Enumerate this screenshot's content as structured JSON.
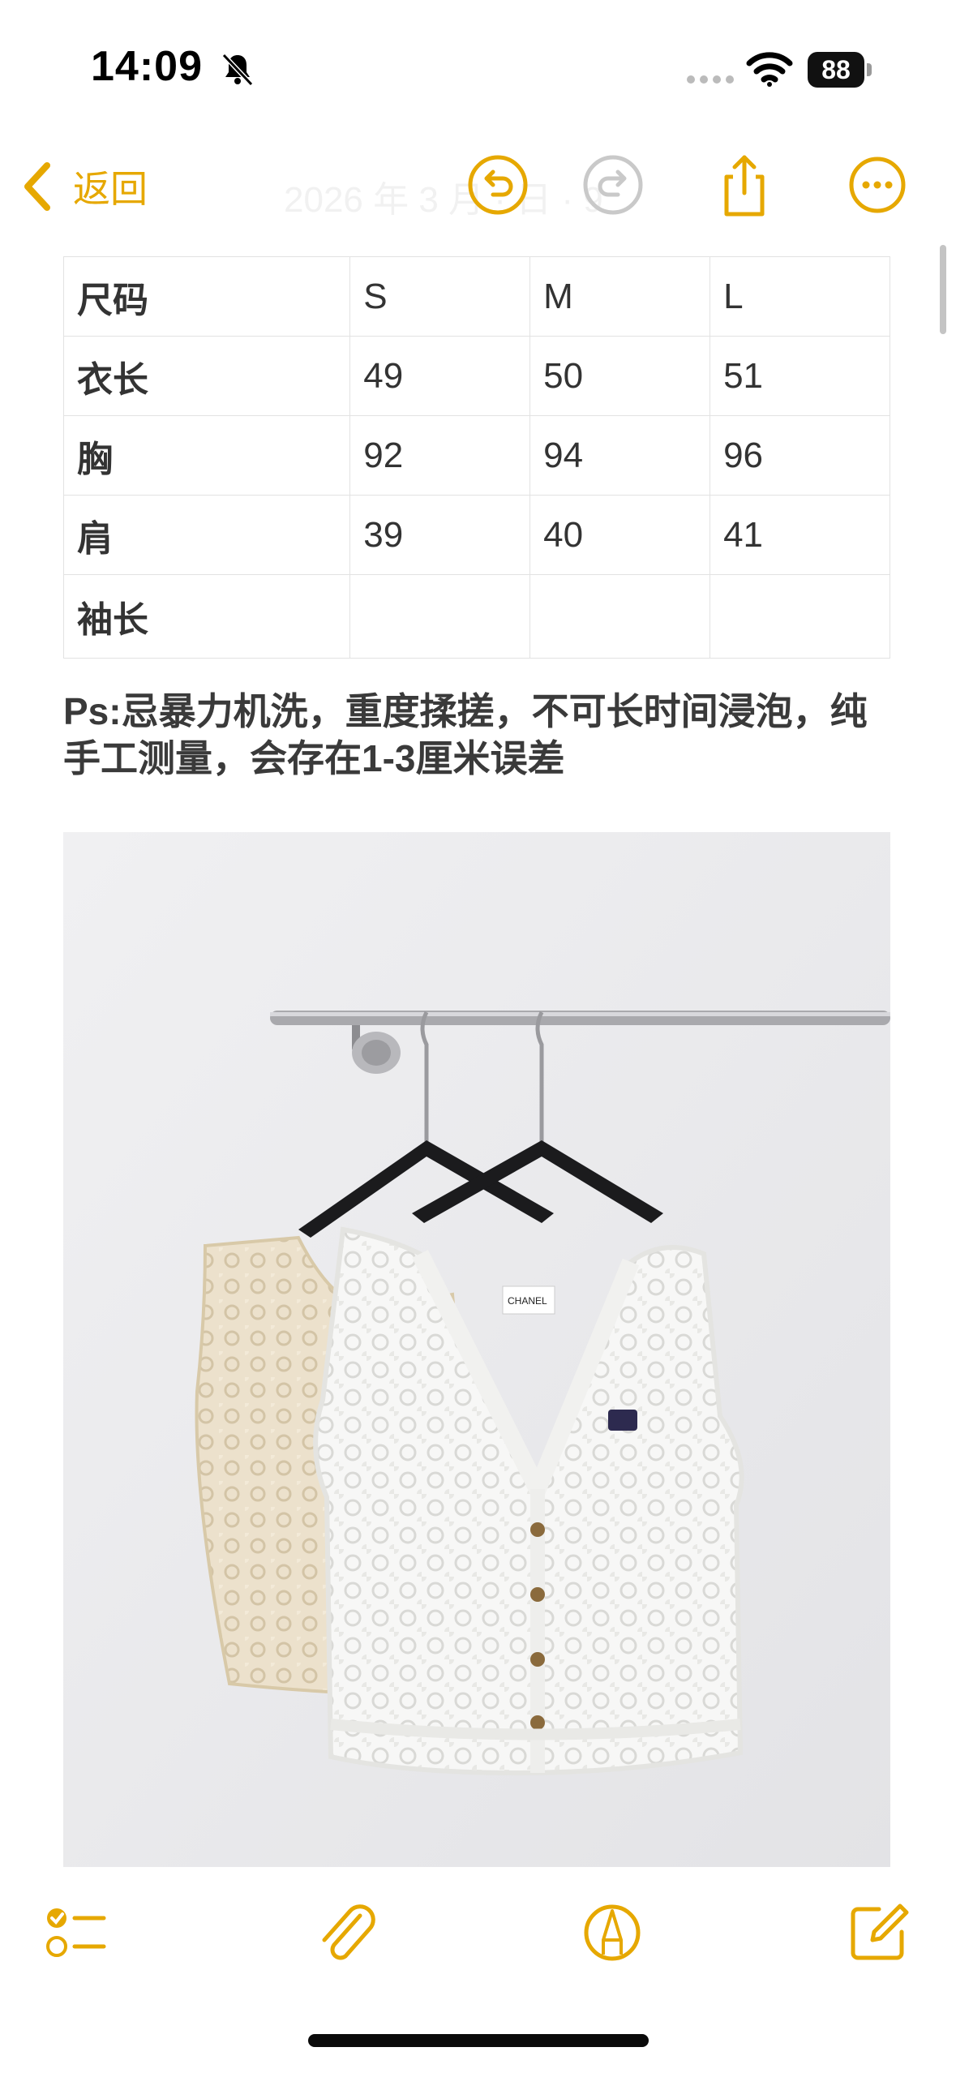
{
  "status_bar": {
    "time": "14:09",
    "battery": "88",
    "icons": [
      "bell-slash-icon",
      "cellular-dots-icon",
      "wifi-icon",
      "battery-icon"
    ]
  },
  "nav": {
    "back_label": "返回",
    "faded_title": "2026 年 3 月 · 日 · 9",
    "icons": [
      "undo-icon",
      "redo-icon",
      "share-icon",
      "more-icon"
    ],
    "accent_color": "#e6a800"
  },
  "size_table": {
    "header": [
      "尺码",
      "S",
      "M",
      "L"
    ],
    "rows": [
      [
        "衣长",
        "49",
        "50",
        "51"
      ],
      [
        "胸",
        "92",
        "94",
        "96"
      ],
      [
        "肩",
        "39",
        "40",
        "41"
      ],
      [
        "袖长",
        "",
        "",
        ""
      ]
    ]
  },
  "note_text": "Ps:忌暴力机洗，重度揉搓，不可长时间浸泡，纯手工测量，会存在1-3厘米误差",
  "photo": {
    "subject": "two crochet vests on hangers",
    "label_text": "CHANEL"
  },
  "toolbar": {
    "icons": [
      "checklist-icon",
      "paperclip-icon",
      "markup-pen-icon",
      "compose-icon"
    ]
  }
}
